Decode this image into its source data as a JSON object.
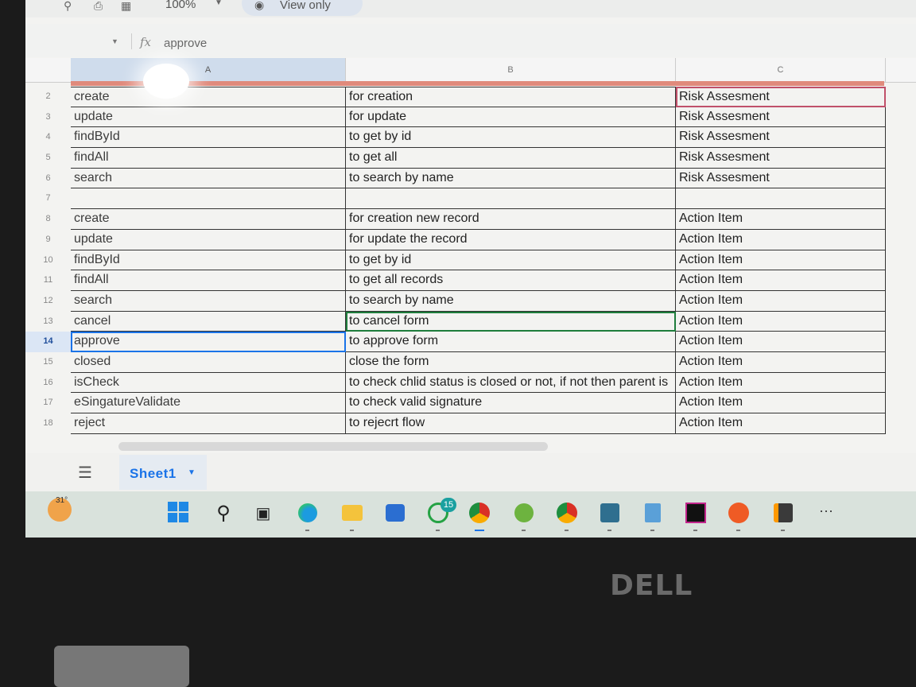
{
  "toolbar": {
    "zoom": "100%",
    "view_mode": "View only",
    "icons": [
      "search-icon",
      "print-icon",
      "format-icon",
      "eye-icon"
    ]
  },
  "formula_bar": {
    "fx": "fx",
    "value": "approve"
  },
  "columns": [
    "A",
    "B",
    "C"
  ],
  "rows": [
    {
      "n": "2",
      "a": "create",
      "b": "for creation",
      "c": "Risk Assesment"
    },
    {
      "n": "3",
      "a": "update",
      "b": "for update",
      "c": "Risk Assesment"
    },
    {
      "n": "4",
      "a": "findById",
      "b": "to get by id",
      "c": "Risk Assesment"
    },
    {
      "n": "5",
      "a": "findAll",
      "b": "to get all",
      "c": "Risk Assesment"
    },
    {
      "n": "6",
      "a": "search",
      "b": "to search by name",
      "c": "Risk Assesment"
    },
    {
      "n": "7",
      "a": "",
      "b": "",
      "c": ""
    },
    {
      "n": "8",
      "a": "create",
      "b": "for creation new record",
      "c": "Action Item"
    },
    {
      "n": "9",
      "a": "update",
      "b": "for update the record",
      "c": "Action Item"
    },
    {
      "n": "10",
      "a": "findById",
      "b": "to get by id",
      "c": "Action Item"
    },
    {
      "n": "11",
      "a": "findAll",
      "b": "to get all records",
      "c": "Action Item"
    },
    {
      "n": "12",
      "a": "search",
      "b": "to search by name",
      "c": "Action Item"
    },
    {
      "n": "13",
      "a": "cancel",
      "b": "to cancel form",
      "c": "Action Item"
    },
    {
      "n": "14",
      "a": "approve",
      "b": "to approve form",
      "c": "Action Item"
    },
    {
      "n": "15",
      "a": "closed",
      "b": "close the form",
      "c": "Action Item"
    },
    {
      "n": "16",
      "a": "isCheck",
      "b": "to check chlid status is closed or not, if not then parent is",
      "c": "Action Item"
    },
    {
      "n": "17",
      "a": "eSingatureValidate",
      "b": "to check valid signature",
      "c": "Action Item"
    },
    {
      "n": "18",
      "a": "reject",
      "b": "to rejecrt flow",
      "c": "Action Item"
    }
  ],
  "selected_row": "14",
  "sheet_tab": {
    "name": "Sheet1"
  },
  "taskbar": {
    "weather_temp": "31°",
    "whatsapp_badge": "15",
    "more": "···",
    "apps": [
      "windows-start-icon",
      "search-icon",
      "task-view-icon",
      "edge-icon",
      "file-explorer-icon",
      "store-icon",
      "whatsapp-icon",
      "chrome-icon",
      "spring-icon",
      "chrome-profile-icon",
      "mysql-workbench-icon",
      "notepad-icon",
      "intellij-icon",
      "postman-icon",
      "sublime-icon"
    ]
  },
  "device": {
    "logo": "DELL"
  },
  "colors": {
    "selection_blue": "#1a73e8",
    "selected_col_header": "#cfdcec",
    "highlight_green": "#1e7d3c",
    "highlight_red": "#c0506a",
    "band_red": "#e08a7c"
  }
}
